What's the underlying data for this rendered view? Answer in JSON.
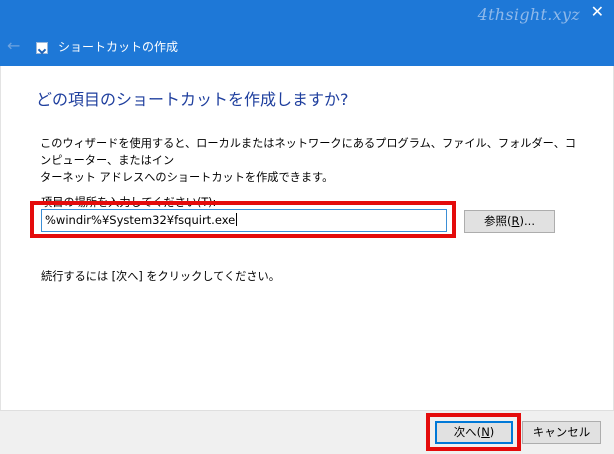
{
  "titlebar": {
    "title": "ショートカットの作成",
    "watermark": "4thsight.xyz",
    "close_glyph": "✕",
    "back_glyph": "←",
    "accent_color": "#1e78d7"
  },
  "wizard": {
    "heading": "どの項目のショートカットを作成しますか?",
    "description_line1": "このウィザードを使用すると、ローカルまたはネットワークにあるプログラム、ファイル、フォルダー、コンピューター、またはイン",
    "description_line2": "ターネット アドレスへのショートカットを作成できます。",
    "location_label": "項目の場所を入力してください(T):",
    "location_value": "%windir%¥System32¥fsquirt.exe",
    "browse_label_pre": "参照(",
    "browse_label_key": "R",
    "browse_label_post": ")...",
    "hint": "続行するには [次へ] をクリックしてください。"
  },
  "footer": {
    "next_label_pre": "次へ(",
    "next_label_key": "N",
    "next_label_post": ")",
    "cancel_label": "キャンセル"
  },
  "highlight_color": "#e40b0b"
}
